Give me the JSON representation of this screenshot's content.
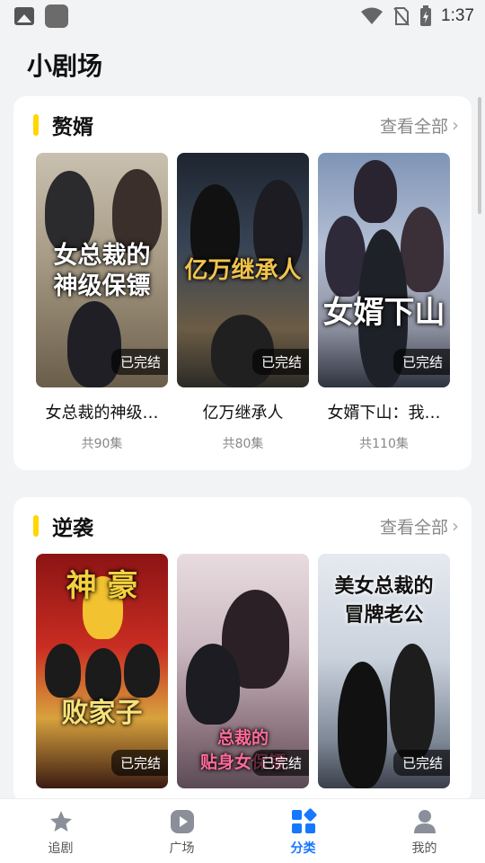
{
  "status_bar": {
    "time": "1:37"
  },
  "page": {
    "title": "小剧场"
  },
  "sections": [
    {
      "title": "赘婿",
      "see_all": "查看全部",
      "items": [
        {
          "title": "女总裁的神级…",
          "count": "共90集",
          "badge": "已完结",
          "poster_text": "女总裁的\n神级保镖"
        },
        {
          "title": "亿万继承人",
          "count": "共80集",
          "badge": "已完结",
          "poster_text": "亿万继承人"
        },
        {
          "title": "女婿下山：我…",
          "count": "共110集",
          "badge": "已完结",
          "poster_text": "女婿下山"
        }
      ]
    },
    {
      "title": "逆袭",
      "see_all": "查看全部",
      "items": [
        {
          "badge": "已完结",
          "poster_text": "神豪\n败家子"
        },
        {
          "badge": "已完结",
          "poster_text": "总裁的贴身女保镖"
        },
        {
          "badge": "已完结",
          "poster_text": "美女总裁的冒牌老公"
        }
      ]
    }
  ],
  "tab_bar": {
    "tabs": [
      {
        "label": "追剧",
        "icon": "star-icon"
      },
      {
        "label": "广场",
        "icon": "play-icon"
      },
      {
        "label": "分类",
        "icon": "category-icon",
        "active": true
      },
      {
        "label": "我的",
        "icon": "person-icon"
      }
    ]
  },
  "colors": {
    "accent": "#ffd600",
    "active_tab": "#1677ff"
  }
}
